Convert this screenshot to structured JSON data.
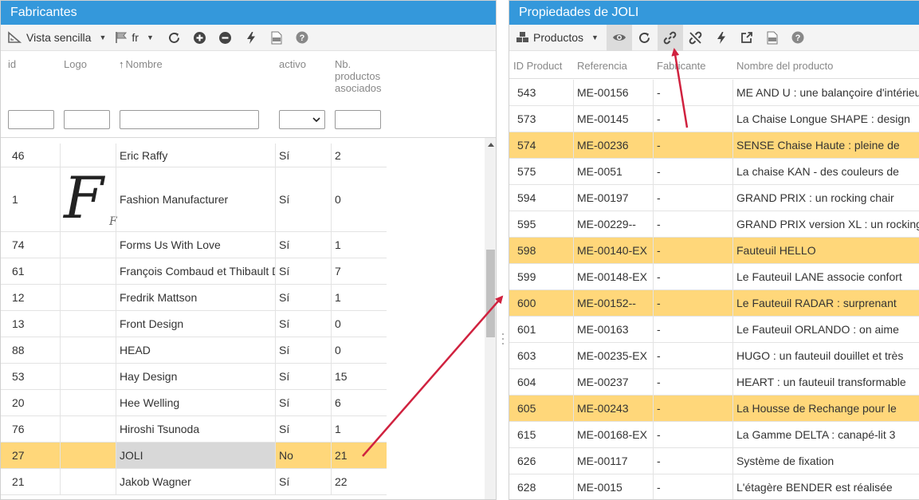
{
  "left": {
    "title": "Fabricantes",
    "toolbar": {
      "view_label": "Vista sencilla",
      "lang_label": "fr"
    },
    "columns": {
      "id": "id",
      "logo": "Logo",
      "name": "Nombre",
      "active": "activo",
      "count_l1": "Nb.",
      "count_l2": "productos",
      "count_l3": "asociados"
    },
    "rows": [
      {
        "id": "46",
        "name": "Eric Raffy",
        "active": "Sí",
        "count": "2"
      },
      {
        "id": "1",
        "name": "Fashion Manufacturer",
        "active": "Sí",
        "count": "0"
      },
      {
        "id": "74",
        "name": "Forms Us With Love",
        "active": "Sí",
        "count": "1"
      },
      {
        "id": "61",
        "name": "François Combaud et Thibault Desombre",
        "active": "Sí",
        "count": "7"
      },
      {
        "id": "12",
        "name": "Fredrik Mattson",
        "active": "Sí",
        "count": "1"
      },
      {
        "id": "13",
        "name": "Front Design",
        "active": "Sí",
        "count": "0"
      },
      {
        "id": "88",
        "name": "HEAD",
        "active": "Sí",
        "count": "0"
      },
      {
        "id": "53",
        "name": "Hay Design",
        "active": "Sí",
        "count": "15"
      },
      {
        "id": "20",
        "name": "Hee Welling",
        "active": "Sí",
        "count": "6"
      },
      {
        "id": "76",
        "name": "Hiroshi Tsunoda",
        "active": "Sí",
        "count": "1"
      },
      {
        "id": "27",
        "name": "JOLI",
        "active": "No",
        "count": "21"
      },
      {
        "id": "21",
        "name": "Jakob Wagner",
        "active": "Sí",
        "count": "22"
      }
    ],
    "logo_glyph": "F",
    "logo_glyph_small": "F"
  },
  "right": {
    "title": "Propiedades de JOLI",
    "toolbar": {
      "products_label": "Productos"
    },
    "columns": {
      "id": "ID Product",
      "ref": "Referencia",
      "manufacturer": "Fabricante",
      "name": "Nombre del producto"
    },
    "rows": [
      {
        "id": "543",
        "ref": "ME-00156",
        "manufacturer": "-",
        "name": "ME AND U : une balançoire d'intérieur"
      },
      {
        "id": "573",
        "ref": "ME-00145",
        "manufacturer": "-",
        "name": "La Chaise Longue SHAPE : design"
      },
      {
        "id": "574",
        "ref": "ME-00236",
        "manufacturer": "-",
        "name": "SENSE Chaise Haute : pleine de"
      },
      {
        "id": "575",
        "ref": "ME-0051",
        "manufacturer": "-",
        "name": "La chaise KAN - des couleurs de"
      },
      {
        "id": "594",
        "ref": "ME-00197",
        "manufacturer": "-",
        "name": "GRAND PRIX : un rocking chair"
      },
      {
        "id": "595",
        "ref": "ME-00229--",
        "manufacturer": "-",
        "name": "GRAND PRIX version XL : un rocking"
      },
      {
        "id": "598",
        "ref": "ME-00140-EX",
        "manufacturer": "-",
        "name": "Fauteuil HELLO"
      },
      {
        "id": "599",
        "ref": "ME-00148-EX",
        "manufacturer": "-",
        "name": "Le Fauteuil LANE associe confort"
      },
      {
        "id": "600",
        "ref": "ME-00152--",
        "manufacturer": "-",
        "name": "Le Fauteuil RADAR : surprenant"
      },
      {
        "id": "601",
        "ref": "ME-00163",
        "manufacturer": "-",
        "name": "Le Fauteuil ORLANDO : on aime"
      },
      {
        "id": "603",
        "ref": "ME-00235-EX",
        "manufacturer": "-",
        "name": "HUGO : un fauteuil douillet et très"
      },
      {
        "id": "604",
        "ref": "ME-00237",
        "manufacturer": "-",
        "name": "HEART : un fauteuil transformable"
      },
      {
        "id": "605",
        "ref": "ME-00243",
        "manufacturer": "-",
        "name": "La Housse de Rechange pour le"
      },
      {
        "id": "615",
        "ref": "ME-00168-EX",
        "manufacturer": "-",
        "name": "La Gamme DELTA : canapé-lit 3"
      },
      {
        "id": "626",
        "ref": "ME-00117",
        "manufacturer": "-",
        "name": "Système de fixation"
      },
      {
        "id": "628",
        "ref": "ME-0015",
        "manufacturer": "-",
        "name": "L'étagère BENDER est réalisée"
      }
    ]
  },
  "colors": {
    "header": "#3498db",
    "highlight": "#ffd77a",
    "selected_cell": "#d8d8d8",
    "annotation_arrow": "#d0223f"
  }
}
